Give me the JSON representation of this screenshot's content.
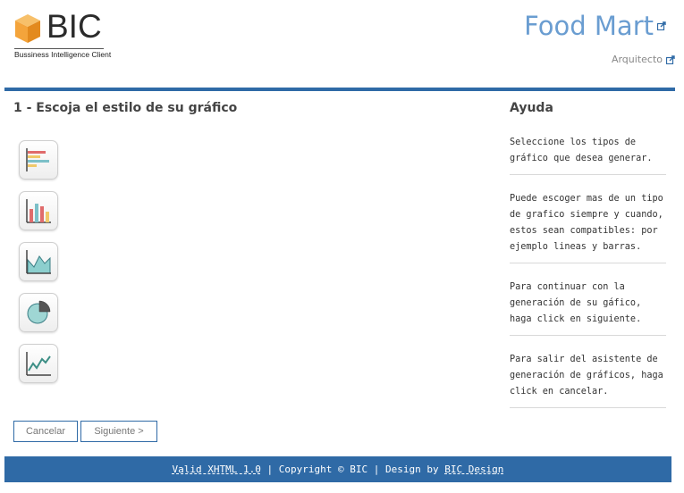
{
  "brand": {
    "logo_text": "BIC",
    "logo_subtitle": "Bussiness Intelligence Client",
    "colors": {
      "accent": "#2f6aa6",
      "title": "#6a9dd1",
      "cube": "#f4a43b"
    }
  },
  "header": {
    "site_title": "Food Mart",
    "user_link": "Arquitecto",
    "external_icon": "external-link-icon"
  },
  "main": {
    "step_title": "1 - Escoja el estilo de su gráfico",
    "chart_options": [
      {
        "icon": "horizontal-bar-chart-icon"
      },
      {
        "icon": "vertical-bar-chart-icon"
      },
      {
        "icon": "area-chart-icon"
      },
      {
        "icon": "pie-chart-icon"
      },
      {
        "icon": "line-chart-icon"
      }
    ],
    "buttons": {
      "cancel": "Cancelar",
      "next": "Siguiente >"
    }
  },
  "help": {
    "title": "Ayuda",
    "items": [
      "Seleccione los tipos de gráfico que desea generar.",
      "Puede escoger mas de un tipo de grafico siempre y cuando, estos sean compatibles: por ejemplo lineas y barras.",
      "Para continuar con la generación de su gáfico, haga click en siguiente.",
      "Para salir del asistente de generación de gráficos, haga click en cancelar."
    ]
  },
  "footer": {
    "valid_link": "Valid XHTML 1.0",
    "sep1": " | ",
    "copyright": "Copyright © BIC",
    "sep2": " | Design by ",
    "design_link": "BIC Design"
  }
}
